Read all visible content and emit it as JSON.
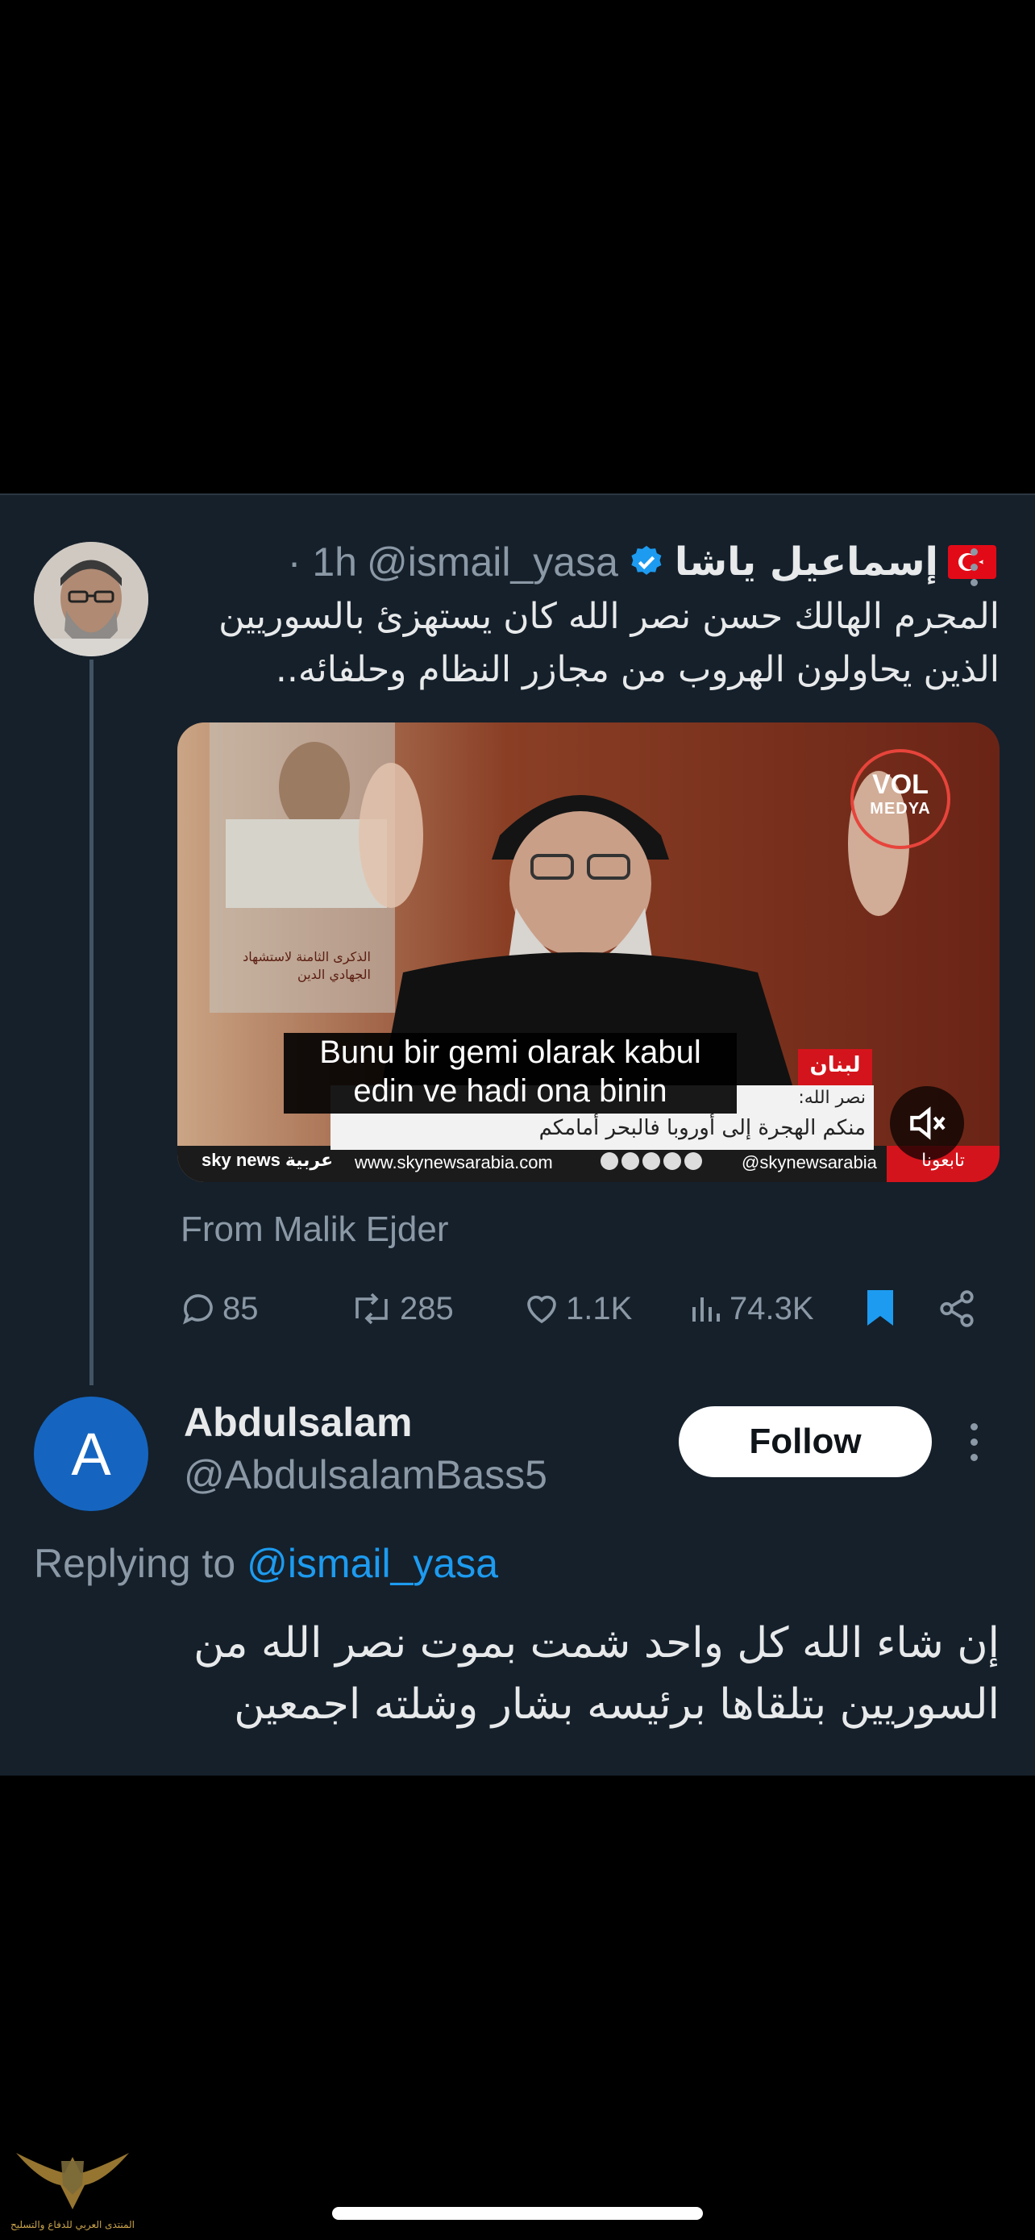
{
  "tweet": {
    "display_name": "إسماعيل ياشا",
    "flag_emoji": "🇹🇷",
    "handle": "@ismail_yasa",
    "time": "· 1h",
    "text": "المجرم الهالك حسن نصر الله كان يستهزئ بالسوريين الذين يحاولون الهروب من مجازر النظام وحلفائه..",
    "from": "From Malik Ejder",
    "video": {
      "subtitle_line1": "Bunu bir gemi olarak kabul",
      "subtitle_line2": "edin ve hadi ona binin",
      "watermark_top": "VOL",
      "watermark_bottom": "MEDYA",
      "ticker_label": "لبنان",
      "ticker_line1": "نصر الله:",
      "ticker_line2": "منكم الهجرة إلى أوروبا فالبحر أمامكم",
      "channel": "sky news",
      "channel_ar": "عربية",
      "site": "www.skynewsarabia.com",
      "social_handle": "@skynewsarabia",
      "follow_tag": "تابعونا",
      "poster_text": "الذكرى الثامنة لاستشهاد الجهادي الدين"
    },
    "actions": {
      "replies": "85",
      "retweets": "285",
      "likes": "1.1K",
      "views": "74.3K"
    }
  },
  "reply": {
    "avatar_letter": "A",
    "display_name": "Abdulsalam",
    "handle": "@AbdulsalamBass5",
    "follow_label": "Follow",
    "replying_prefix": "Replying to",
    "replying_to": "@ismail_yasa",
    "text": "إن شاء الله كل واحد شمت بموت نصر الله من السوريين بتلقاها برئيسه بشار وشلته اجمعين"
  },
  "watermark": {
    "text": "المنتدى العربي للدفاع والتسليح"
  },
  "colors": {
    "background": "#000000",
    "panel": "#15202b",
    "accent": "#1d9bf0",
    "muted": "#8b98a5",
    "bookmark": "#1d9bf0"
  }
}
